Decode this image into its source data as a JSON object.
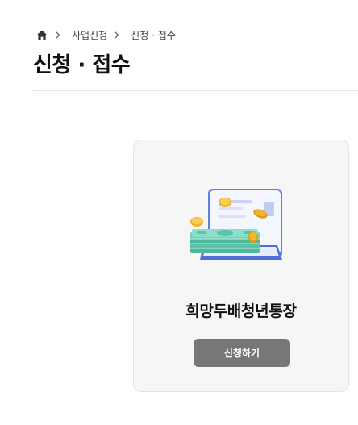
{
  "breadcrumb": {
    "home_icon": "home-icon",
    "separator_icon": "chevron-right-icon",
    "items": [
      "사업신청",
      "신청 · 접수"
    ]
  },
  "page": {
    "title": "신청 · 접수"
  },
  "card": {
    "illustration": "money-wallet-illustration",
    "title": "희망두배청년통장",
    "button_label": "신청하기"
  },
  "colors": {
    "button_bg": "#777779",
    "card_bg": "#f6f6f7",
    "wallet_accent": "#5b7fe0",
    "money_green": "#6fd2b6",
    "coin_gold": "#f2b62a"
  }
}
